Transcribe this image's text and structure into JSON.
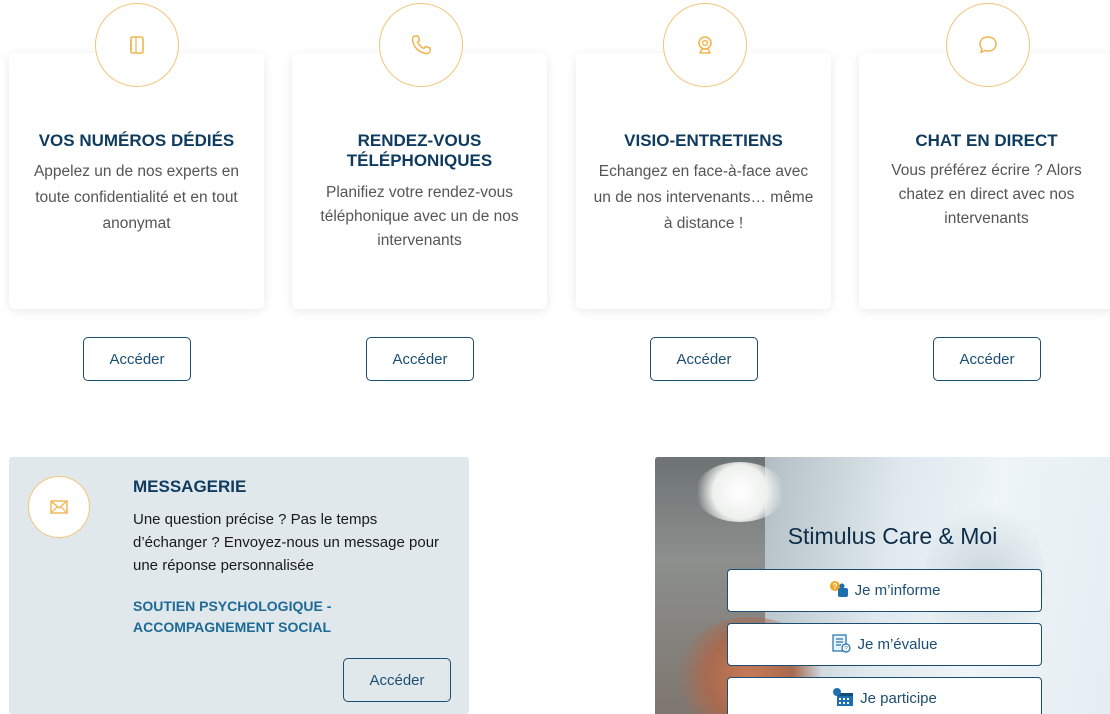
{
  "cards": [
    {
      "icon": "notebook-icon",
      "title": "VOS NUMÉROS DÉDIÉS",
      "desc": "Appelez un de nos experts en toute confidentialité et en tout anonymat",
      "button": "Accéder"
    },
    {
      "icon": "phone-icon",
      "title": "RENDEZ-VOUS TÉLÉPHONIQUES",
      "desc": "Planifiez votre rendez-vous téléphonique avec un de nos intervenants",
      "button": "Accéder"
    },
    {
      "icon": "webcam-icon",
      "title": "VISIO-ENTRETIENS",
      "desc": "Echangez en face-à-face avec un de nos intervenants… même à distance !",
      "button": "Accéder"
    },
    {
      "icon": "chat-bubble-icon",
      "title": "CHAT EN DIRECT",
      "desc": "Vous préférez écrire ? Alors chatez en direct avec nos intervenants",
      "button": "Accéder"
    }
  ],
  "messagerie": {
    "icon": "envelope-icon",
    "title": "MESSAGERIE",
    "desc": "Une question précise ? Pas le temps d’échanger ? Envoyez-nous un message pour une réponse personnalisée",
    "link": "SOUTIEN PSYCHOLOGIQUE - ACCOMPAGNEMENT SOCIAL",
    "button": "Accéder"
  },
  "promo": {
    "title": "Stimulus Care & Moi",
    "buttons": [
      {
        "icon": "info-person-icon",
        "label": "Je m’informe"
      },
      {
        "icon": "checklist-icon",
        "label": "Je m’évalue"
      },
      {
        "icon": "calendar-icon",
        "label": "Je participe"
      }
    ]
  },
  "colors": {
    "accent": "#f2c57a",
    "brand": "#1c4e73",
    "title": "#0e3b5e",
    "panel": "#e1e8ec"
  }
}
